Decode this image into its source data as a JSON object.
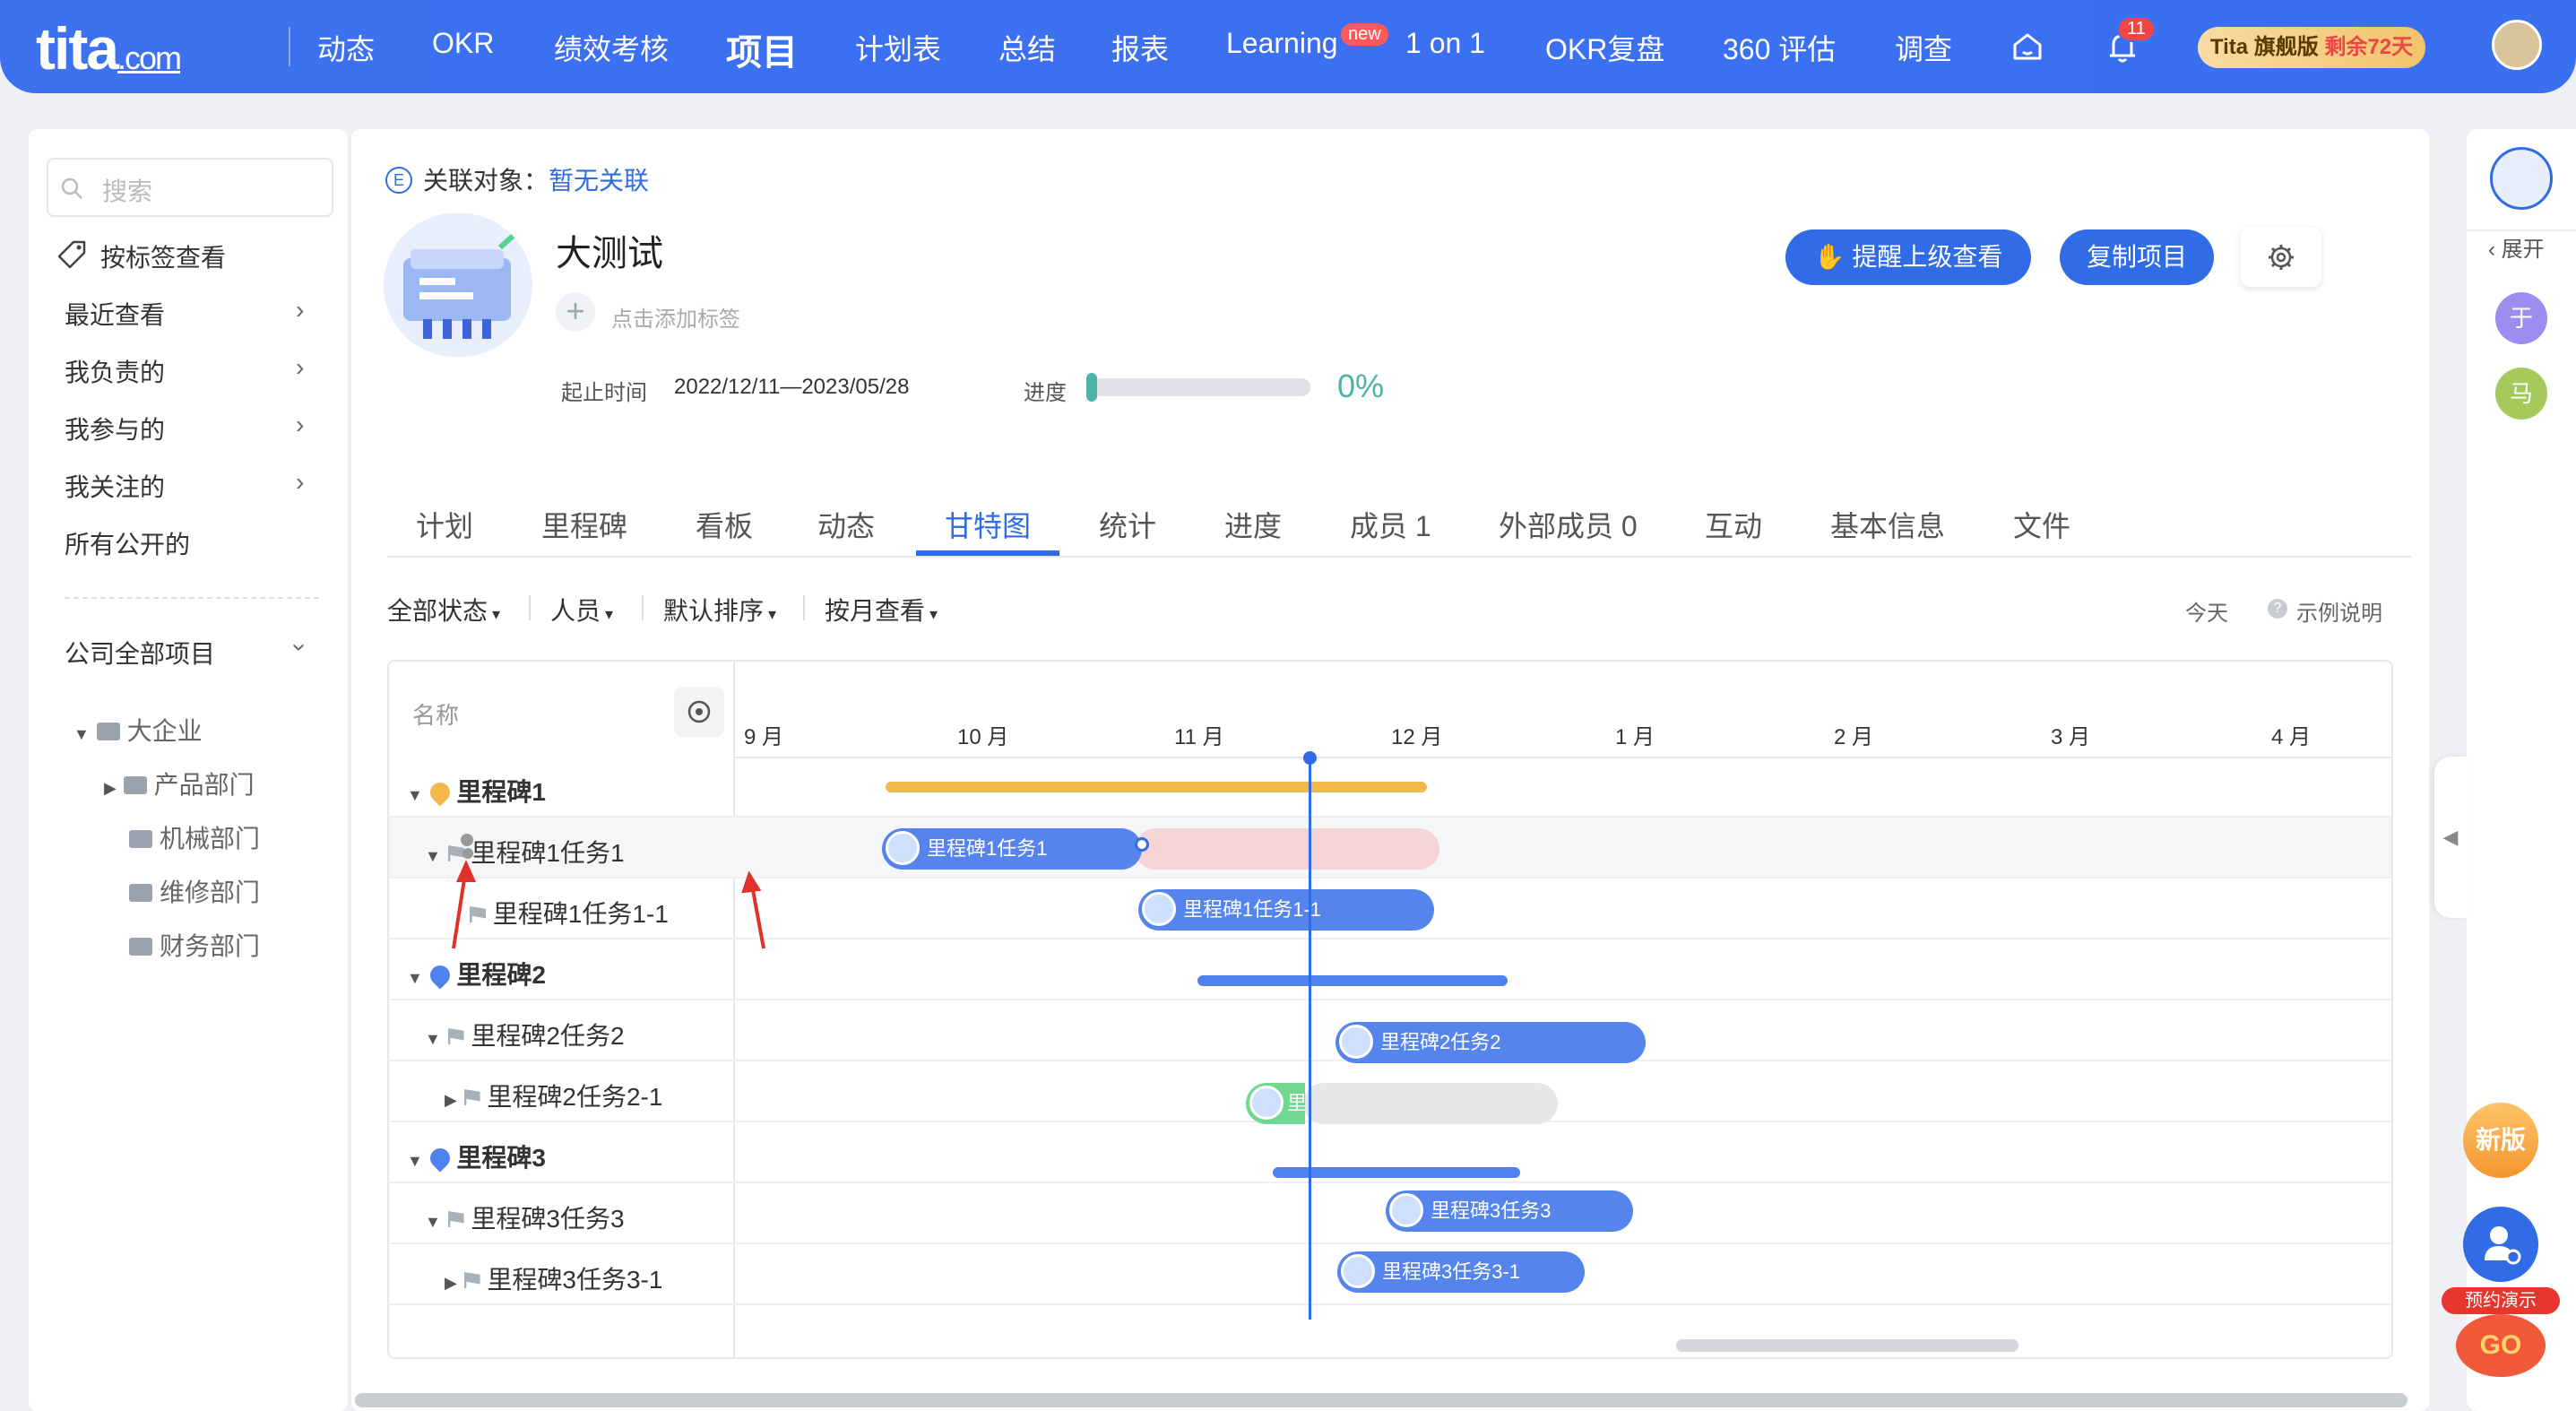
{
  "nav": {
    "logo": "tita",
    "logo_suffix": ".com",
    "items": [
      "动态",
      "OKR",
      "绩效考核",
      "项目",
      "计划表",
      "总结",
      "报表",
      "Learning",
      "1 on 1",
      "OKR复盘",
      "360 评估",
      "调查"
    ],
    "new_badge": "new",
    "bell_count": "11",
    "plan_badge_prefix": "Tita 旗舰版",
    "plan_badge_suffix": "剩余72天"
  },
  "sidebar": {
    "search_placeholder": "搜索",
    "by_tag": "按标签查看",
    "items": [
      "最近查看",
      "我负责的",
      "我参与的",
      "我关注的",
      "所有公开的"
    ],
    "company_projects": "公司全部项目",
    "tree": {
      "root": "大企业",
      "children": [
        "产品部门",
        "机械部门",
        "维修部门",
        "财务部门"
      ]
    }
  },
  "project": {
    "relation_label": "关联对象：",
    "relation_value": "暂无关联",
    "title": "大测试",
    "add_tag": "点击添加标签",
    "date_label": "起止时间",
    "date_value": "2022/12/11—2023/05/28",
    "progress_label": "进度",
    "progress_value": "0%",
    "progress_fraction": 0,
    "remind_button": "提醒上级查看",
    "copy_button": "复制项目"
  },
  "tabs": [
    "计划",
    "里程碑",
    "看板",
    "动态",
    "甘特图",
    "统计",
    "进度",
    "成员 1",
    "外部成员 0",
    "互动",
    "基本信息",
    "文件"
  ],
  "active_tab": "甘特图",
  "filters": [
    "全部状态",
    "人员",
    "默认排序",
    "按月查看"
  ],
  "today": "今天",
  "legend": "示例说明",
  "gantt": {
    "name_header": "名称",
    "months": [
      "9 月",
      "10 月",
      "11 月",
      "12 月",
      "1 月",
      "2 月",
      "3 月",
      "4 月"
    ],
    "rows": [
      {
        "name": "里程碑1",
        "type": "milestone"
      },
      {
        "name": "里程碑1任务1",
        "type": "task",
        "bar_label": "里程碑1任务1"
      },
      {
        "name": "里程碑1任务1-1",
        "type": "subtask",
        "bar_label": "里程碑1任务1-1"
      },
      {
        "name": "里程碑2",
        "type": "milestone"
      },
      {
        "name": "里程碑2任务2",
        "type": "task",
        "bar_label": "里程碑2任务2"
      },
      {
        "name": "里程碑2任务2-1",
        "type": "subtask",
        "bar_label": "里程"
      },
      {
        "name": "里程碑3",
        "type": "milestone"
      },
      {
        "name": "里程碑3任务3",
        "type": "task",
        "bar_label": "里程碑3任务3"
      },
      {
        "name": "里程碑3任务3-1",
        "type": "subtask",
        "bar_label": "里程碑3任务3-1"
      }
    ]
  },
  "rail": {
    "expand": "展开",
    "avatars": [
      "于",
      "马"
    ],
    "new_version": "新版",
    "demo": "预约演示",
    "go": "GO"
  },
  "colors": {
    "brand": "#3d71f0",
    "milestone1": "#f3b84c",
    "bar": "#5585ec",
    "overdue": "#f6d3d6",
    "done": "#73d88f",
    "progress": "#4bb3a7"
  }
}
